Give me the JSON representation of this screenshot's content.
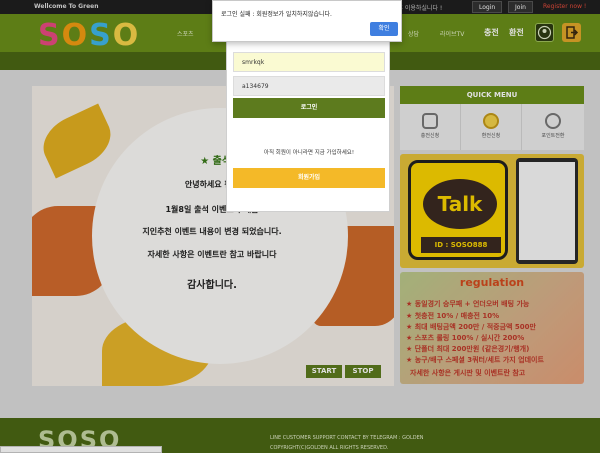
{
  "topbar": {
    "welcome": "Wellcome To Green",
    "message_tail": "인 후 이용하실니다 !",
    "login": "Login",
    "join": "Join",
    "register": "Register now !"
  },
  "header": {
    "logo": [
      "S",
      "O",
      "S",
      "O"
    ],
    "nav": [
      "스포츠",
      "상담",
      "라이브TV"
    ],
    "nav_big": [
      "충전",
      "환전"
    ]
  },
  "banner": {
    "title": "★ 출석 이",
    "lines": [
      "안녕하세요 편리",
      "1월8일 출석 이벤트가 새롭",
      "지인추천 이벤트 내용이 변경 되었습니다.",
      "자세한 사항은 이벤트란 참고 바랍니다",
      "감사합니다."
    ],
    "start": "START",
    "stop": "STOP"
  },
  "quick_menu": {
    "title": "QUICK MENU",
    "items": [
      "충전신청",
      "환전신청",
      "포인트전환"
    ]
  },
  "talk": {
    "bubble": "Talk",
    "id": "ID : SOSO888"
  },
  "regulation": {
    "title": "regulation",
    "rules": [
      "★ 동일경기 승무패 + 언더오버 배팅 가능",
      "★ 첫충전 10% / 매충전 10%",
      "★ 최대 배팅금액 200만 / 적중금액 500만",
      "★ 스포츠 롤링 100% / 실시간 200%",
      "★ 단폴더 최대 200만원 (같은경기/행개)",
      "★ 농구/배구 스페셜 3쿼터/세트 가지 업데이트",
      "자세한 사항은 게시판 및 이벤트란 참고"
    ]
  },
  "login": {
    "username": "smrkqk",
    "password": "a134679",
    "login_button": "로그인",
    "not_member": "아직 회원이 아니라면 지금 가입하세요!",
    "signup_button": "회원가입"
  },
  "alert": {
    "message": "로그인 실패 : 회원정보가 일치하지않습니다.",
    "ok": "확인"
  },
  "footer": {
    "logo": "SOSO",
    "line1": "LINE CUSTOMER SUPPORT CONTACT BY TELEGRAM : GOLDEN",
    "line2": "COPYRIGHT(C)GOLDEN ALL RIGHTS RESERVED."
  },
  "colors": {
    "green": "#6a8f1a",
    "dark_green": "#4a6714",
    "yellow": "#f4b928",
    "alert_blue": "#3f7fe0"
  }
}
